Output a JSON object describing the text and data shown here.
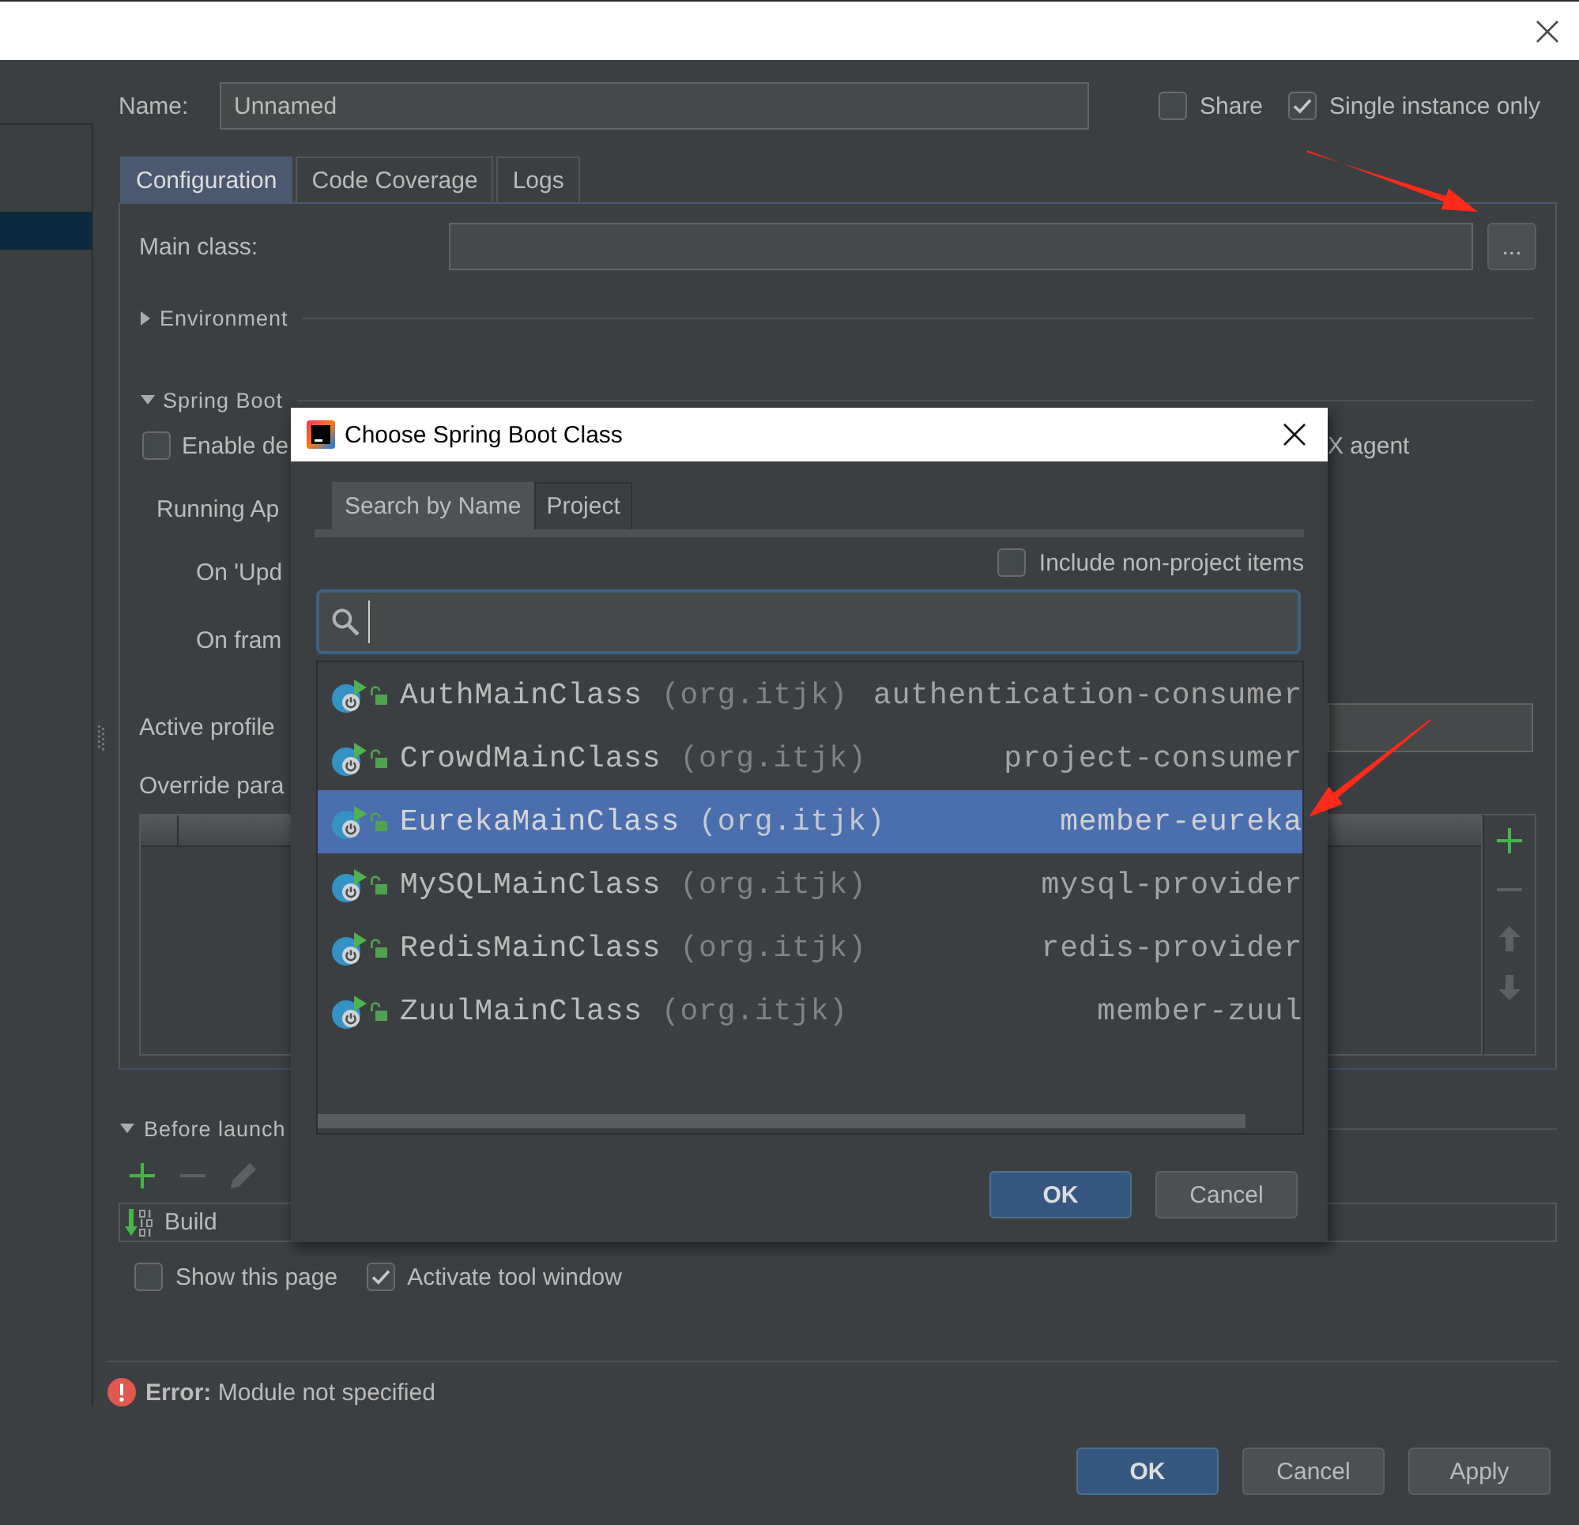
{
  "sidebar": {
    "items": [
      {
        "selected": true
      }
    ]
  },
  "name_row": {
    "label": "Name:",
    "value": "Unnamed",
    "options": [
      {
        "label": "Share",
        "checked": false
      },
      {
        "label": "Single instance only",
        "checked": true
      }
    ]
  },
  "tabs": [
    {
      "label": "Configuration",
      "selected": true
    },
    {
      "label": "Code Coverage",
      "selected": false
    },
    {
      "label": "Logs",
      "selected": false
    }
  ],
  "configuration": {
    "main_class": {
      "label": "Main class:",
      "button": "..."
    },
    "environment": {
      "title": "Environment",
      "expanded": false
    },
    "spring_boot": {
      "title": "Spring Boot",
      "expanded": true,
      "enable_option": {
        "label": "Enable de",
        "checked": false
      },
      "agent_text": "X agent",
      "running_label": "Running Ap",
      "on_update_label": "On 'Upd",
      "on_frame_label": "On fram",
      "active_profiles_label": "Active profile",
      "override_label": "Override para",
      "toolbar": [
        {
          "kind": "add",
          "disabled": false
        },
        {
          "kind": "remove",
          "disabled": true
        },
        {
          "kind": "up",
          "disabled": true
        },
        {
          "kind": "down",
          "disabled": true
        }
      ]
    }
  },
  "before_launch": {
    "title": "Before launch",
    "expanded": true,
    "toolbar": [
      {
        "kind": "add",
        "disabled": false
      },
      {
        "kind": "remove",
        "disabled": true
      },
      {
        "kind": "edit",
        "disabled": true
      }
    ],
    "tasks": [
      {
        "label": "Build"
      }
    ],
    "options": [
      {
        "label": "Show this page",
        "checked": false
      },
      {
        "label": "Activate tool window",
        "checked": true
      }
    ]
  },
  "error": {
    "text": "**Error:** Module not specified"
  },
  "buttons": [
    {
      "label": "OK",
      "kind": "ok"
    },
    {
      "label": "Cancel",
      "kind": "cancel"
    },
    {
      "label": "Apply",
      "kind": "apply"
    }
  ],
  "dialog": {
    "title": "Choose Spring Boot Class",
    "tabs": [
      {
        "label": "Search by Name",
        "selected": true
      },
      {
        "label": "Project",
        "selected": false
      }
    ],
    "include_option": {
      "label": "Include non-project items",
      "checked": false
    },
    "results": [
      {
        "name": "AuthMainClass",
        "package": "(org.itjk)",
        "module": "authentication-consumer",
        "selected": false
      },
      {
        "name": "CrowdMainClass",
        "package": "(org.itjk)",
        "module": "project-consumer",
        "selected": false
      },
      {
        "name": "EurekaMainClass",
        "package": "(org.itjk)",
        "module": "member-eureka",
        "selected": true
      },
      {
        "name": "MySQLMainClass",
        "package": "(org.itjk)",
        "module": "mysql-provider",
        "selected": false
      },
      {
        "name": "RedisMainClass",
        "package": "(org.itjk)",
        "module": "redis-provider",
        "selected": false
      },
      {
        "name": "ZuulMainClass",
        "package": "(org.itjk)",
        "module": "member-zuul",
        "selected": false
      }
    ],
    "buttons": [
      {
        "label": "OK",
        "kind": "ok"
      },
      {
        "label": "Cancel",
        "kind": "cancel"
      }
    ]
  }
}
